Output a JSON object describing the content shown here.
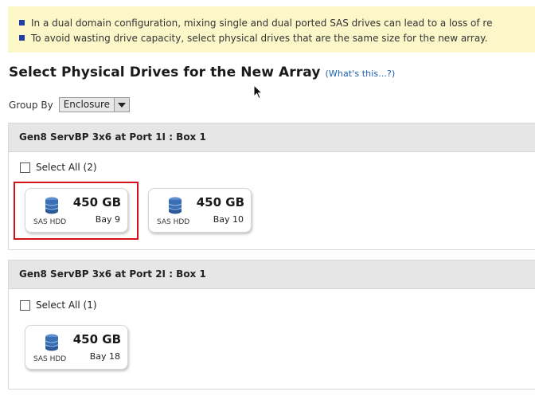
{
  "notice": {
    "lines": [
      "In a dual domain configuration, mixing single and dual ported SAS drives can lead to a loss of re",
      "To avoid wasting drive capacity, select physical drives that are the same size for the new array."
    ],
    "bullet_color": "#1f3fa6",
    "background": "#fbf7c9"
  },
  "page": {
    "title": "Select Physical Drives for the New Array",
    "whats_this": "(What's this...?)"
  },
  "group_by": {
    "label": "Group By",
    "selected": "Enclosure"
  },
  "sections": [
    {
      "header": "Gen8 ServBP 3x6 at Port 1I : Box 1",
      "select_all": "Select All (2)",
      "drives": [
        {
          "capacity": "450 GB",
          "type": "SAS HDD",
          "bay": "Bay 9",
          "highlighted": true
        },
        {
          "capacity": "450 GB",
          "type": "SAS HDD",
          "bay": "Bay 10",
          "highlighted": false
        }
      ]
    },
    {
      "header": "Gen8 ServBP 3x6 at Port 2I : Box 1",
      "select_all": "Select All (1)",
      "drives": [
        {
          "capacity": "450 GB",
          "type": "SAS HDD",
          "bay": "Bay 18",
          "highlighted": false
        }
      ]
    }
  ],
  "colors": {
    "highlight": "#d1121b",
    "link": "#1a5fb4",
    "drive_icon": "#3a6fb5"
  }
}
